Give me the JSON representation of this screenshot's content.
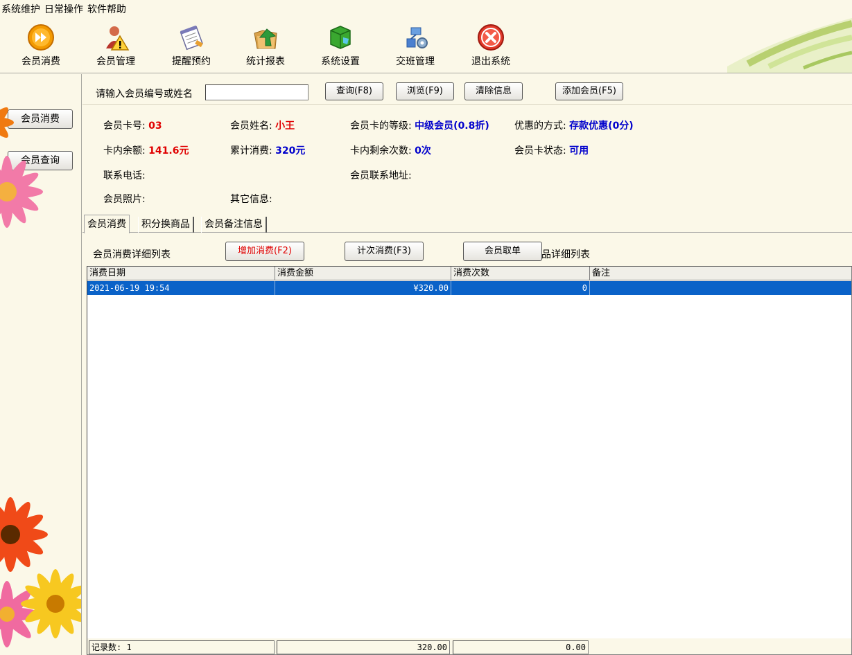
{
  "menu": [
    "系统维护",
    "日常操作",
    "软件帮助"
  ],
  "toolbar": [
    {
      "label": "会员消费",
      "icon": "forward-circle-icon"
    },
    {
      "label": "会员管理",
      "icon": "warning-person-icon"
    },
    {
      "label": "提醒预约",
      "icon": "notepad-icon"
    },
    {
      "label": "统计报表",
      "icon": "folder-arrow-icon"
    },
    {
      "label": "系统设置",
      "icon": "green-cube-icon"
    },
    {
      "label": "交班管理",
      "icon": "network-gear-icon"
    },
    {
      "label": "退出系统",
      "icon": "exit-x-icon"
    }
  ],
  "sidebar": {
    "consume_button": "会员消费",
    "query_button": "会员查询"
  },
  "search": {
    "label": "请输入会员编号或姓名",
    "value": "",
    "query_button": "查询(F8)",
    "browse_button": "浏览(F9)",
    "clear_button": "清除信息",
    "add_member_button": "添加会员(F5)"
  },
  "member": {
    "card_no_label": "会员卡号:",
    "card_no": "03",
    "name_label": "会员姓名:",
    "name": "小王",
    "level_label": "会员卡的等级:",
    "level": "中级会员(0.8折)",
    "discount_label": "优惠的方式:",
    "discount": "存款优惠(0分)",
    "balance_label": "卡内余额:",
    "balance": "141.6元",
    "total_label": "累计消费:",
    "total": "320元",
    "remaining_label": "卡内剩余次数:",
    "remaining": "0次",
    "status_label": "会员卡状态:",
    "status": "可用",
    "phone_label": "联系电话:",
    "address_label": "会员联系地址:",
    "photo_label": "会员照片:",
    "other_label": "其它信息:"
  },
  "tabs": [
    "会员消费",
    "积分换商品",
    "会员备注信息"
  ],
  "actions": {
    "list_title": "会员消费详细列表",
    "add_consume": "增加消费(F2)",
    "count_consume": "计次消费(F3)",
    "cancel_order": "会员取单",
    "list_title_tail": "品详细列表"
  },
  "grid": {
    "columns": [
      "消费日期",
      "消费金额",
      "消费次数",
      "备注"
    ],
    "rows": [
      {
        "date": "2021-06-19 19:54",
        "amount": "¥320.00",
        "count": "0",
        "note": ""
      }
    ],
    "footer": {
      "records": "记录数: 1",
      "amount_sum": "320.00",
      "count_sum": "0.00"
    }
  },
  "colors": {
    "accent_red": "#e00000",
    "accent_blue": "#0000cc",
    "selection": "#0a62c8",
    "background": "#fbf8e8"
  }
}
